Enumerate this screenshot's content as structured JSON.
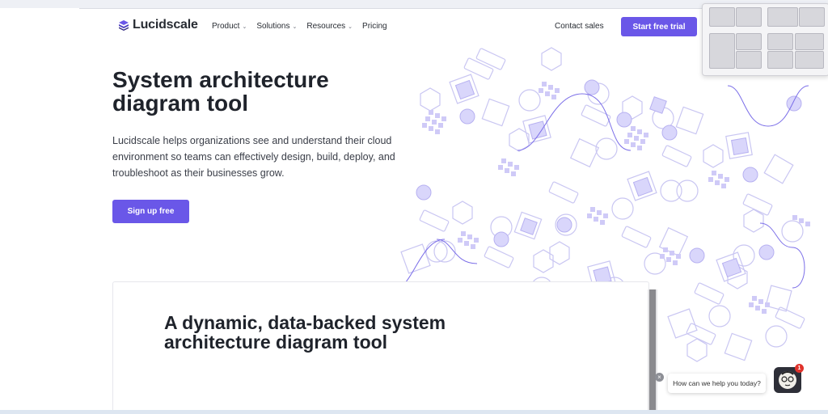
{
  "brand": {
    "name": "Lucidscale",
    "accent": "#6a57e8"
  },
  "nav": {
    "items": [
      {
        "label": "Product",
        "has_dropdown": true
      },
      {
        "label": "Solutions",
        "has_dropdown": true
      },
      {
        "label": "Resources",
        "has_dropdown": true
      },
      {
        "label": "Pricing",
        "has_dropdown": false
      }
    ],
    "contact_label": "Contact sales",
    "cta_label": "Start free trial"
  },
  "hero": {
    "title": "System architecture diagram tool",
    "description": "Lucidscale helps organizations see and understand their cloud environment so teams can effectively design, build, deploy, and troubleshoot as their businesses grow.",
    "button_label": "Sign up free"
  },
  "section": {
    "title": "A dynamic, data-backed system architecture diagram tool"
  },
  "chat": {
    "prompt": "How can we help you today?",
    "close_symbol": "×",
    "unread_count": "1"
  }
}
